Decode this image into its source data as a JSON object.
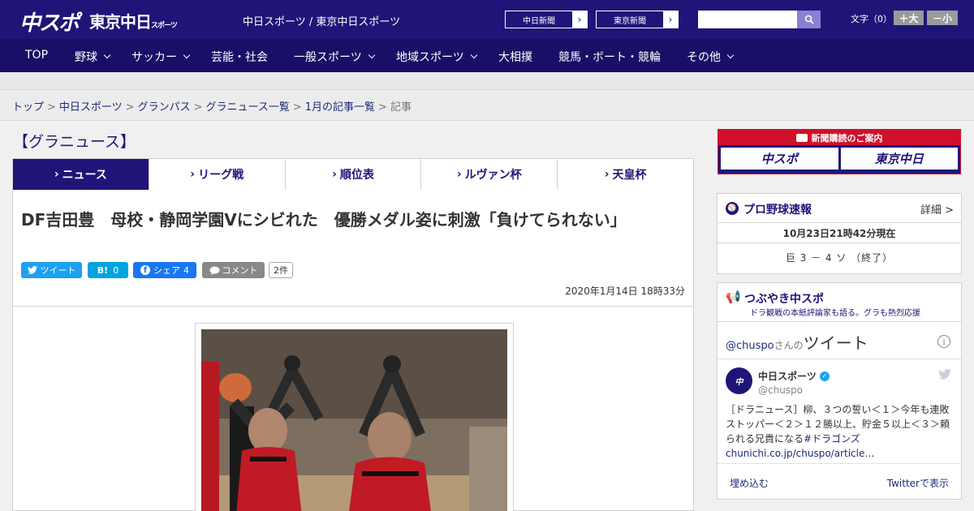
{
  "header": {
    "logo_main": "中スポ",
    "logo_tokyo": "東京中日",
    "logo_tokyo_small": "スポーツ",
    "site_names": "中日スポーツ / 東京中日スポーツ",
    "site_button_1": "中日新聞",
    "site_button_2": "東京新聞",
    "text_size_label": "文字（0）",
    "size_up": "＋大",
    "size_down": "－小"
  },
  "nav": {
    "items": [
      "TOP",
      "野球",
      "サッカー",
      "芸能・社会",
      "一般スポーツ",
      "地域スポーツ",
      "大相撲",
      "競馬・ボート・競輪",
      "その他"
    ]
  },
  "breadcrumb": {
    "items": [
      "トップ",
      "中日スポーツ",
      "グランパス",
      "グラニュース一覧",
      "1月の記事一覧"
    ],
    "current": "記事",
    "sep": ">"
  },
  "section_title": "【グラニュース】",
  "tabs": [
    "ニュース",
    "リーグ戦",
    "順位表",
    "ルヴァン杯",
    "天皇杯"
  ],
  "article": {
    "headline": "DF吉田豊　母校・静岡学園Vにシビれた　優勝メダル姿に刺激「負けてられない」",
    "tweet_label": "ツイート",
    "hatena_label": "B!",
    "hatena_count": "0",
    "share_label": "シェア",
    "share_count": "4",
    "comment_label": "コメント",
    "comment_count": "2件",
    "date": "2020年1月14日 18時33分"
  },
  "sidebar": {
    "subscribe_header": "新聞購読のご案内",
    "subscribe_logo_1": "中スポ",
    "subscribe_logo_2": "東京中日",
    "baseball": {
      "title": "プロ野球速報",
      "detail_label": "詳細 >",
      "timestamp": "10月23日21時42分現在",
      "score": "巨 3 － 4 ソ （終了）"
    },
    "twitter": {
      "title": "つぶやき中スポ",
      "subtitle": "ドラ観戦の本紙評論家も語る。グラも熱烈応援",
      "handle_prefix": "@chuspo",
      "handle_suffix": "さんの",
      "tweets_label": "ツイート",
      "account_name": "中日スポーツ",
      "account_handle": "@chuspo",
      "tweet_text": "［ドラニュース］柳、３つの誓い＜１＞今年も連敗ストッパー＜２＞１２勝以上、貯金５以上＜３＞頼られる兄貴になる",
      "tweet_hashtag": "#ドラゴンズ",
      "tweet_link": "chunichi.co.jp/chuspo/article…",
      "embed_label": "埋め込む",
      "view_on_twitter": "Twitterで表示"
    }
  },
  "colors": {
    "brand_navy": "#1f1578",
    "nav_bg": "#1a0f66",
    "accent_red": "#d0102b",
    "twitter_blue": "#1da1f2",
    "hatena_blue": "#00a4de",
    "facebook_blue": "#1877f2"
  }
}
